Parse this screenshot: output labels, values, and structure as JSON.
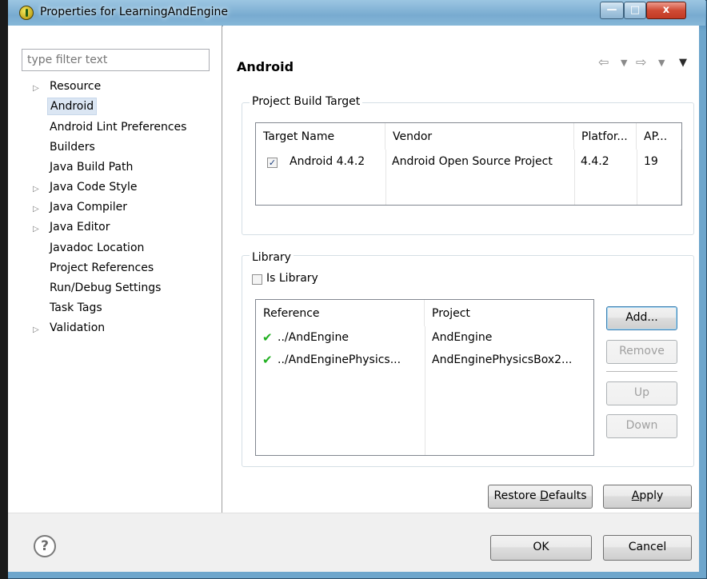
{
  "window": {
    "title": "Properties for LearningAndEngine",
    "close_glyph": "x"
  },
  "filter": {
    "placeholder": "type filter text"
  },
  "tree": [
    {
      "label": "Resource",
      "expandable": true
    },
    {
      "label": "Android",
      "expandable": false,
      "selected": true
    },
    {
      "label": "Android Lint Preferences",
      "expandable": false
    },
    {
      "label": "Builders",
      "expandable": false
    },
    {
      "label": "Java Build Path",
      "expandable": false
    },
    {
      "label": "Java Code Style",
      "expandable": true
    },
    {
      "label": "Java Compiler",
      "expandable": true
    },
    {
      "label": "Java Editor",
      "expandable": true
    },
    {
      "label": "Javadoc Location",
      "expandable": false
    },
    {
      "label": "Project References",
      "expandable": false
    },
    {
      "label": "Run/Debug Settings",
      "expandable": false
    },
    {
      "label": "Task Tags",
      "expandable": false
    },
    {
      "label": "Validation",
      "expandable": true
    }
  ],
  "page": {
    "title": "Android"
  },
  "build_target": {
    "group_label": "Project Build Target",
    "columns": [
      "Target Name",
      "Vendor",
      "Platfor...",
      "AP..."
    ],
    "rows": [
      {
        "checked": true,
        "target": "Android 4.4.2",
        "vendor": "Android Open Source Project",
        "platform": "4.4.2",
        "api": "19"
      }
    ]
  },
  "library": {
    "group_label": "Library",
    "is_library_label": "Is Library",
    "is_library_checked": false,
    "columns": [
      "Reference",
      "Project"
    ],
    "rows": [
      {
        "reference": "../AndEngine",
        "project": "AndEngine"
      },
      {
        "reference": "../AndEnginePhysics...",
        "project": "AndEnginePhysicsBox2..."
      }
    ],
    "buttons": {
      "add": "Add...",
      "remove": "Remove",
      "up": "Up",
      "down": "Down"
    }
  },
  "actions": {
    "restore_defaults_pre": "Restore ",
    "restore_defaults_mnemonic": "D",
    "restore_defaults_post": "efaults",
    "apply_mnemonic": "A",
    "apply_post": "pply",
    "ok": "OK",
    "cancel": "Cancel"
  },
  "help_glyph": "?"
}
